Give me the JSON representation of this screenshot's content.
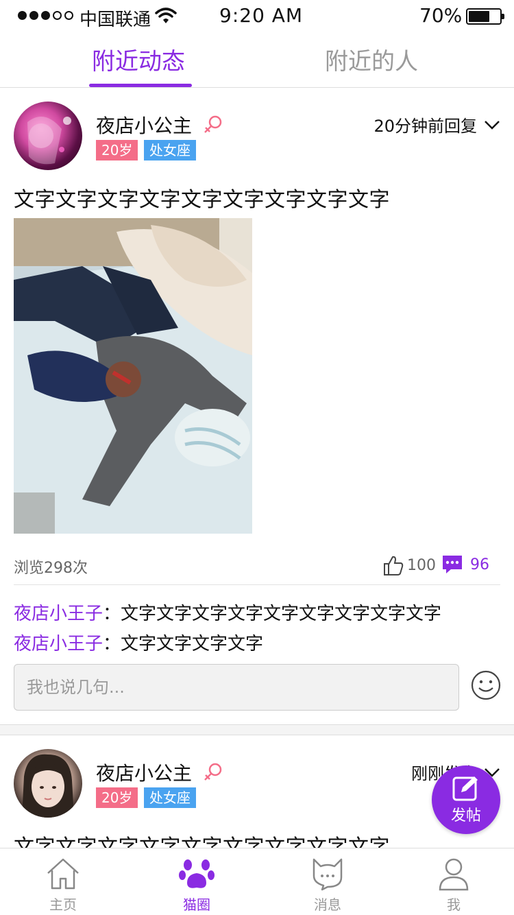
{
  "status_bar": {
    "carrier": "中国联通",
    "time": "9:20 AM",
    "battery": "70%",
    "battery_level": 0.7,
    "signal_strength": 3
  },
  "tabs": [
    {
      "label": "附近动态",
      "active": true
    },
    {
      "label": "附近的人",
      "active": false
    }
  ],
  "posts": [
    {
      "username": "夜店小公主",
      "gender_icon": "female-icon",
      "age": "20岁",
      "zodiac": "处女座",
      "time": "20分钟前回复",
      "text": "文字文字文字文字文字文字文字文字文字",
      "views": "浏览298次",
      "likes": "100",
      "comments_count": "96",
      "comments": [
        {
          "author": "夜店小王子",
          "sep": "：",
          "text": "文字文字文字文字文字文字文字文字文字"
        },
        {
          "author": "夜店小王子",
          "sep": "：",
          "text": "文字文字文字文字"
        }
      ],
      "reply_placeholder": "我也说几句..."
    },
    {
      "username": "夜店小公主",
      "gender_icon": "female-icon",
      "age": "20岁",
      "zodiac": "处女座",
      "time": "刚刚发表",
      "text": "文字文字文字文字文字文字文字文字文字"
    }
  ],
  "fab": {
    "label": "发帖",
    "icon": "edit-icon"
  },
  "bottom_nav": [
    {
      "label": "主页",
      "icon": "home-icon",
      "active": false
    },
    {
      "label": "猫圈",
      "icon": "paw-icon",
      "active": true
    },
    {
      "label": "消息",
      "icon": "cat-message-icon",
      "active": false
    },
    {
      "label": "我",
      "icon": "user-icon",
      "active": false
    }
  ],
  "colors": {
    "accent": "#8a2be2",
    "age_badge": "#f46d88",
    "zodiac_badge": "#4aa3f0",
    "female": "#f46d88"
  }
}
